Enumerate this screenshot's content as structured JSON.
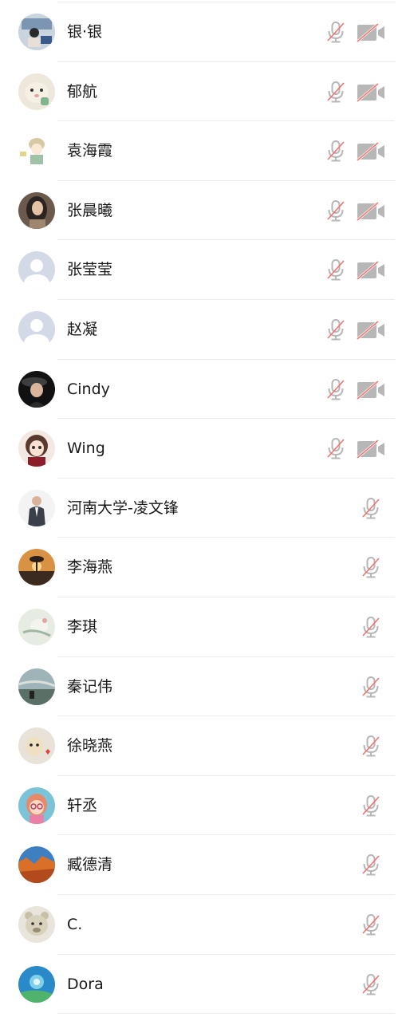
{
  "colors": {
    "icon_gray": "#b7b7b7",
    "slash_red": "#f0746e",
    "divider": "#ececec",
    "text": "#1a1a1a"
  },
  "participants": [
    {
      "name": "银·银",
      "camera_off": true,
      "avatar": "photo-woman-at-desk"
    },
    {
      "name": "郁航",
      "camera_off": true,
      "avatar": "cartoon-cat"
    },
    {
      "name": "袁海霞",
      "camera_off": true,
      "avatar": "cartoon-girl-sketch"
    },
    {
      "name": "张晨曦",
      "camera_off": true,
      "avatar": "photo-woman-portrait"
    },
    {
      "name": "张莹莹",
      "camera_off": true,
      "avatar": "default-avatar"
    },
    {
      "name": "赵凝",
      "camera_off": true,
      "avatar": "default-avatar"
    },
    {
      "name": "Cindy",
      "camera_off": true,
      "avatar": "photo-woman-hat"
    },
    {
      "name": "Wing",
      "camera_off": true,
      "avatar": "cartoon-girl"
    },
    {
      "name": "河南大学-凌文锋",
      "camera_off": false,
      "avatar": "photo-man-suit"
    },
    {
      "name": "李海燕",
      "camera_off": false,
      "avatar": "photo-sunset-tree"
    },
    {
      "name": "李琪",
      "camera_off": false,
      "avatar": "photo-pale-art"
    },
    {
      "name": "秦记伟",
      "camera_off": false,
      "avatar": "photo-seaside-sitting"
    },
    {
      "name": "徐晓燕",
      "camera_off": false,
      "avatar": "photo-puppy"
    },
    {
      "name": "轩丞",
      "camera_off": false,
      "avatar": "cartoon-kid-glasses"
    },
    {
      "name": "臧德清",
      "camera_off": false,
      "avatar": "photo-orange-canyon"
    },
    {
      "name": "C.",
      "camera_off": false,
      "avatar": "photo-plush-bear"
    },
    {
      "name": "Dora",
      "camera_off": false,
      "avatar": "art-blue-flower"
    }
  ]
}
